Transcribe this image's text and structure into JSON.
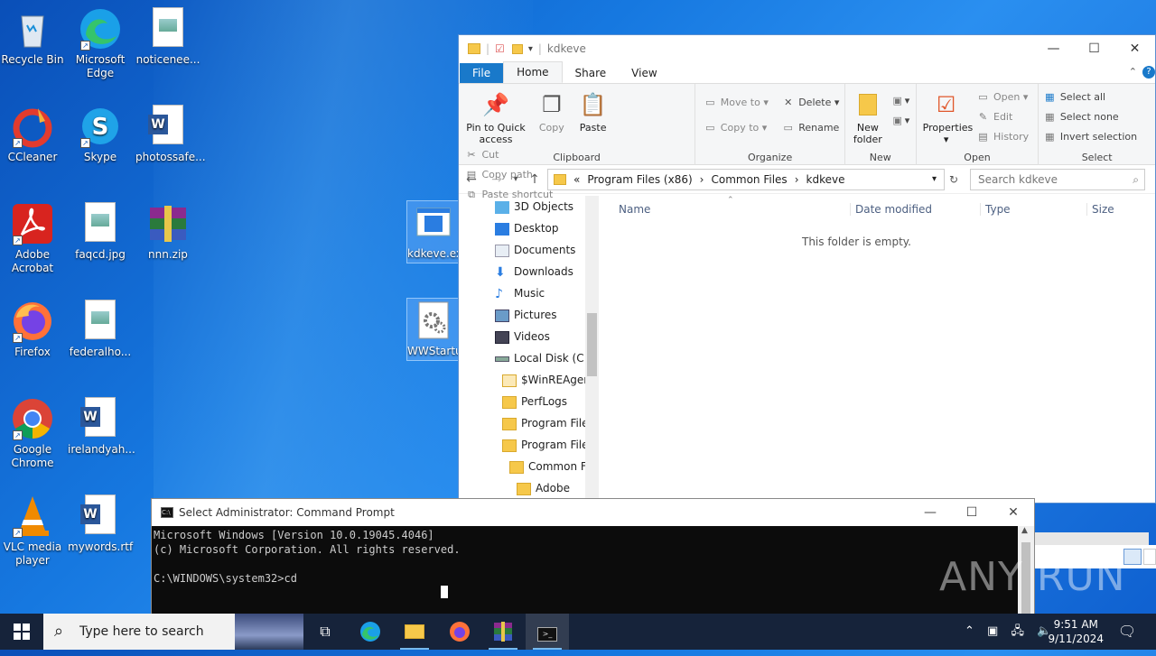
{
  "desktop": {
    "icons": [
      {
        "label": "Recycle Bin"
      },
      {
        "label": "Microsoft\nEdge"
      },
      {
        "label": "noticenee..."
      },
      {
        "label": "CCleaner"
      },
      {
        "label": "Skype"
      },
      {
        "label": "photossafe..."
      },
      {
        "label": "Adobe\nAcrobat"
      },
      {
        "label": "faqcd.jpg"
      },
      {
        "label": "nnn.zip"
      },
      {
        "label": "Firefox"
      },
      {
        "label": "federalho..."
      },
      {
        "label": "Google\nChrome"
      },
      {
        "label": "irelandyah..."
      },
      {
        "label": "VLC media\nplayer"
      },
      {
        "label": "mywords.rtf"
      },
      {
        "label": "kdkeve.ex"
      },
      {
        "label": "WWStartu"
      }
    ]
  },
  "explorer": {
    "title": "kdkeve",
    "tabs": [
      "File",
      "Home",
      "Share",
      "View"
    ],
    "clipboard": {
      "pin": "Pin to Quick access",
      "copy": "Copy",
      "paste": "Paste",
      "cut": "Cut",
      "copy_path": "Copy path",
      "paste_shortcut": "Paste shortcut",
      "label": "Clipboard"
    },
    "organize": {
      "move_to": "Move to",
      "copy_to": "Copy to",
      "delete": "Delete",
      "rename": "Rename",
      "label": "Organize"
    },
    "new": {
      "new_folder": "New folder",
      "label": "New"
    },
    "open": {
      "properties": "Properties",
      "open": "Open",
      "edit": "Edit",
      "history": "History",
      "label": "Open"
    },
    "select": {
      "select_all": "Select all",
      "select_none": "Select none",
      "invert": "Invert selection",
      "label": "Select"
    },
    "path": [
      "«",
      "Program Files (x86)",
      "›",
      "Common Files",
      "›",
      "kdkeve"
    ],
    "search_placeholder": "Search kdkeve",
    "nav": [
      "3D Objects",
      "Desktop",
      "Documents",
      "Downloads",
      "Music",
      "Pictures",
      "Videos",
      "Local Disk (C:)",
      "$WinREAgent",
      "PerfLogs",
      "Program Files",
      "Program Files",
      "Common Fi",
      "Adobe"
    ],
    "columns": [
      "Name",
      "Date modified",
      "Type",
      "Size"
    ],
    "empty_message": "This folder is empty."
  },
  "cmd": {
    "title": "Select Administrator: Command Prompt",
    "lines": [
      "Microsoft Windows [Version 10.0.19045.4046]",
      "(c) Microsoft Corporation. All rights reserved.",
      "",
      "C:\\WINDOWS\\system32>cd"
    ]
  },
  "taskbar": {
    "search_placeholder": "Type here to search",
    "time": "9:51 AM",
    "date": "9/11/2024"
  },
  "watermark": "ANY RUN"
}
